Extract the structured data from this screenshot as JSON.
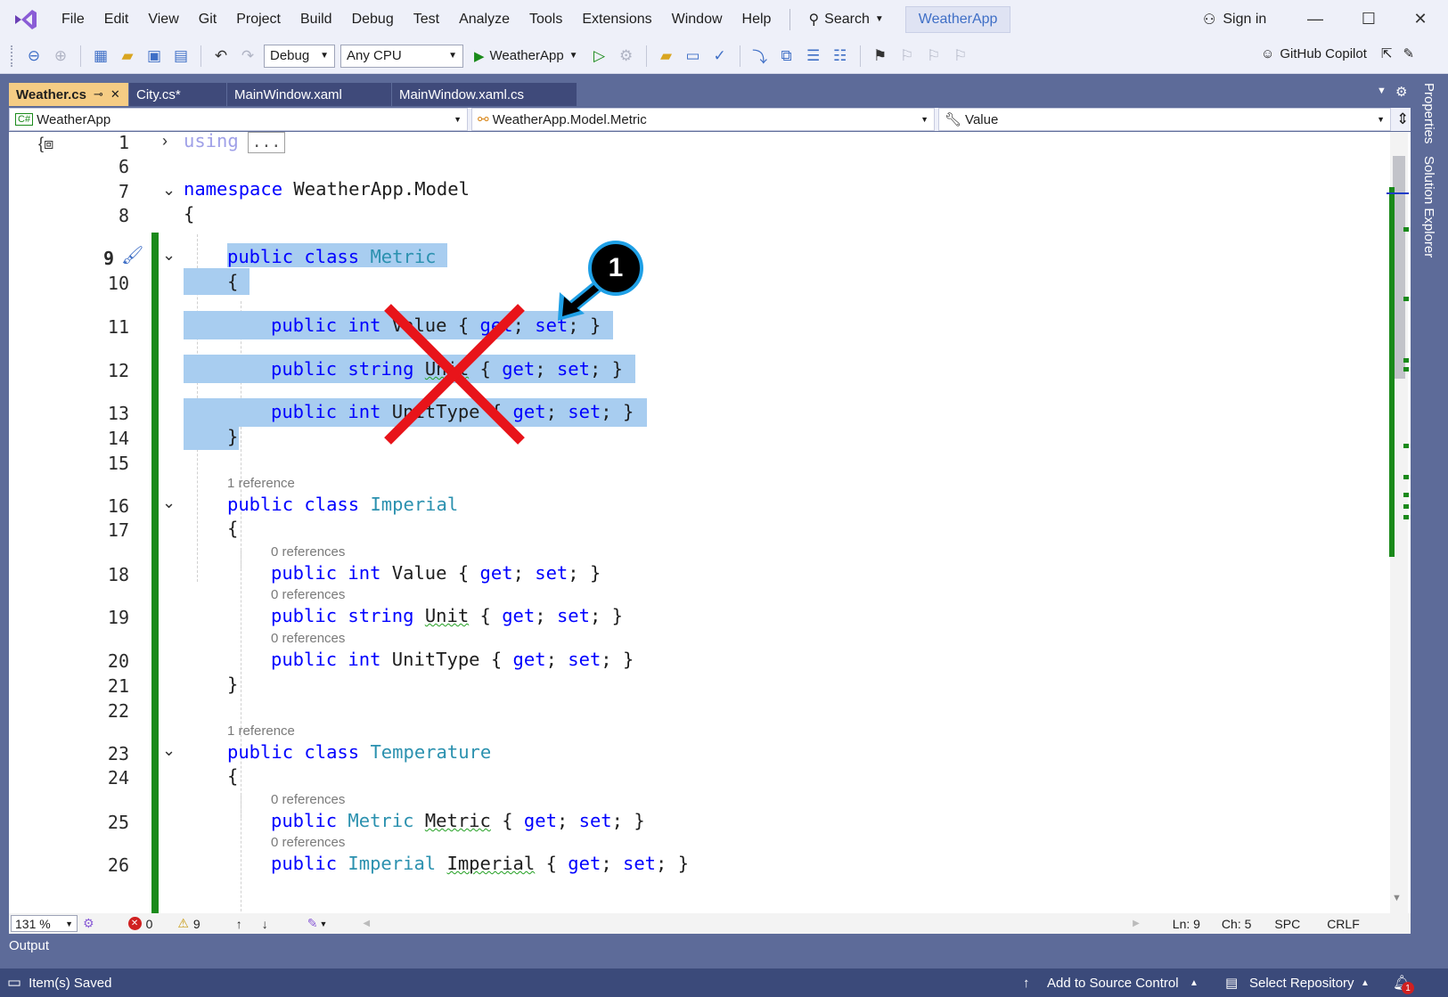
{
  "menu": {
    "items": [
      "File",
      "Edit",
      "View",
      "Git",
      "Project",
      "Build",
      "Debug",
      "Test",
      "Analyze",
      "Tools",
      "Extensions",
      "Window",
      "Help"
    ],
    "search_label": "Search",
    "solution_name": "WeatherApp",
    "sign_in": "Sign in"
  },
  "toolbar": {
    "configuration": "Debug",
    "platform": "Any CPU",
    "run_target": "WeatherApp",
    "copilot": "GitHub Copilot"
  },
  "tabs": [
    {
      "label": "Weather.cs",
      "active": true
    },
    {
      "label": "City.cs*",
      "active": false
    },
    {
      "label": "MainWindow.xaml",
      "active": false
    },
    {
      "label": "MainWindow.xaml.cs",
      "active": false
    }
  ],
  "navbar": {
    "project": "WeatherApp",
    "type": "WeatherApp.Model.Metric",
    "member": "Value"
  },
  "editor": {
    "lines": {
      "n1": "1",
      "n6": "6",
      "n7": "7",
      "n8": "8",
      "n9": "9",
      "n10": "10",
      "n11": "11",
      "n12": "12",
      "n13": "13",
      "n14": "14",
      "n15": "15",
      "n16": "16",
      "n17": "17",
      "n18": "18",
      "n19": "19",
      "n20": "20",
      "n21": "21",
      "n22": "22",
      "n23": "23",
      "n24": "24",
      "n25": "25",
      "n26": "26"
    },
    "code": {
      "using": "using",
      "collapsed": "...",
      "ns_kw": "namespace",
      "ns_name": " WeatherApp.Model",
      "open_brace": "{",
      "close_brace": "}",
      "public": "public",
      "class": "class",
      "int": "int",
      "string": "string",
      "metric_class": "Metric",
      "imperial_class": "Imperial",
      "temperature_class": "Temperature",
      "value_prop": " Value { ",
      "unit_prop": "Unit",
      "unittype_prop": " UnitType { ",
      "get": "get",
      "set": "set",
      "semi": "; ",
      "close_acc": "; }",
      "open_acc": " { ",
      "metric_prop": "Metric",
      "imperial_prop": "Imperial"
    },
    "codelens": {
      "one_ref": "1 reference",
      "zero_refs": "0 references"
    }
  },
  "annotation": {
    "badge": "1"
  },
  "status": {
    "zoom": "131 %",
    "errors": "0",
    "warnings": "9",
    "line": "Ln: 9",
    "col": "Ch: 5",
    "whitespace": "SPC",
    "line_ending": "CRLF",
    "output_tab": "Output",
    "saved": "Item(s) Saved",
    "source_control": "Add to Source Control",
    "repository": "Select Repository",
    "notif_count": "1"
  },
  "side_tabs": [
    "Properties",
    "Solution Explorer"
  ],
  "colors": {
    "accent": "#5d6b99",
    "keyword": "#0000ff",
    "type": "#2b91af",
    "selection": "#a8cdf0",
    "change_bar": "#1a8a1a",
    "active_tab": "#f5cc84"
  }
}
